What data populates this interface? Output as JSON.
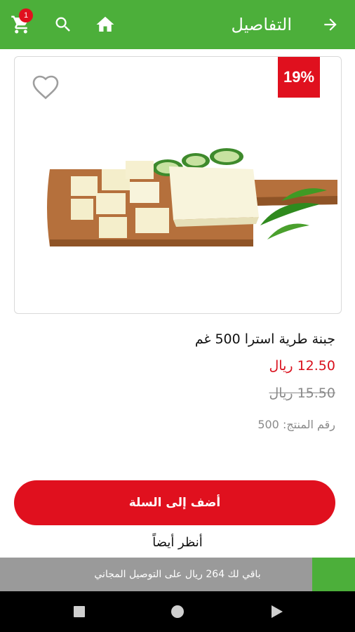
{
  "header": {
    "title": "التفاصيل",
    "cart_count": "1",
    "icons": {
      "cart": "cart-icon",
      "search": "search-icon",
      "home": "home-icon",
      "back": "arrow-right-icon"
    }
  },
  "product": {
    "discount": "19%",
    "name": "جبنة طرية استرا 500 غم",
    "price": "12.50 ريال",
    "old_price": "15.50 ريال",
    "sku": "رقم المنتج: 500",
    "favorite_icon": "heart-outline-icon"
  },
  "actions": {
    "add_to_cart": "أضف إلى السلة",
    "see_also": "أنظر أيضاً"
  },
  "delivery": {
    "message": "باقي لك 264 ريال على التوصيل المجاني",
    "progress": 0.12
  },
  "colors": {
    "primary_green": "#4caf3a",
    "accent_red": "#e0101e"
  }
}
